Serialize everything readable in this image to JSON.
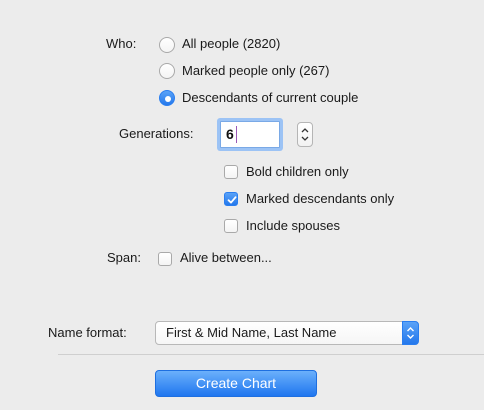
{
  "who": {
    "label": "Who:",
    "options": [
      {
        "label": "All people (2820)",
        "checked": false
      },
      {
        "label": "Marked people only (267)",
        "checked": false
      },
      {
        "label": "Descendants of current couple",
        "checked": true
      }
    ]
  },
  "generations": {
    "label": "Generations:",
    "value": "6"
  },
  "descendant_options": [
    {
      "label": "Bold children only",
      "checked": false
    },
    {
      "label": "Marked descendants only",
      "checked": true
    },
    {
      "label": "Include spouses",
      "checked": false
    }
  ],
  "span": {
    "label": "Span:",
    "checkbox_label": "Alive between...",
    "checked": false
  },
  "name_format": {
    "label": "Name format:",
    "selected": "First & Mid Name, Last Name"
  },
  "create_button": {
    "label": "Create Chart"
  },
  "colors": {
    "accent": "#2478ec",
    "background": "#ececec"
  }
}
